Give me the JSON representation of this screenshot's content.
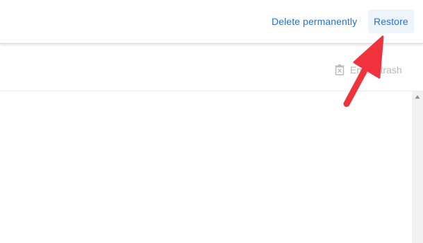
{
  "header": {
    "delete_label": "Delete permanently",
    "restore_label": "Restore"
  },
  "toolbar": {
    "empty_trash_label": "Empty trash",
    "empty_trash_icon": "trash-icon"
  },
  "scrollbar": {
    "up_icon": "scroll-up-arrow-icon"
  },
  "annotation": {
    "arrow_icon": "red-pointer-arrow",
    "arrow_color": "#f0323c"
  },
  "colors": {
    "accent": "#1a73e8",
    "disabled_text": "#b8b8b8",
    "restore_bg": "#eef4fc"
  }
}
